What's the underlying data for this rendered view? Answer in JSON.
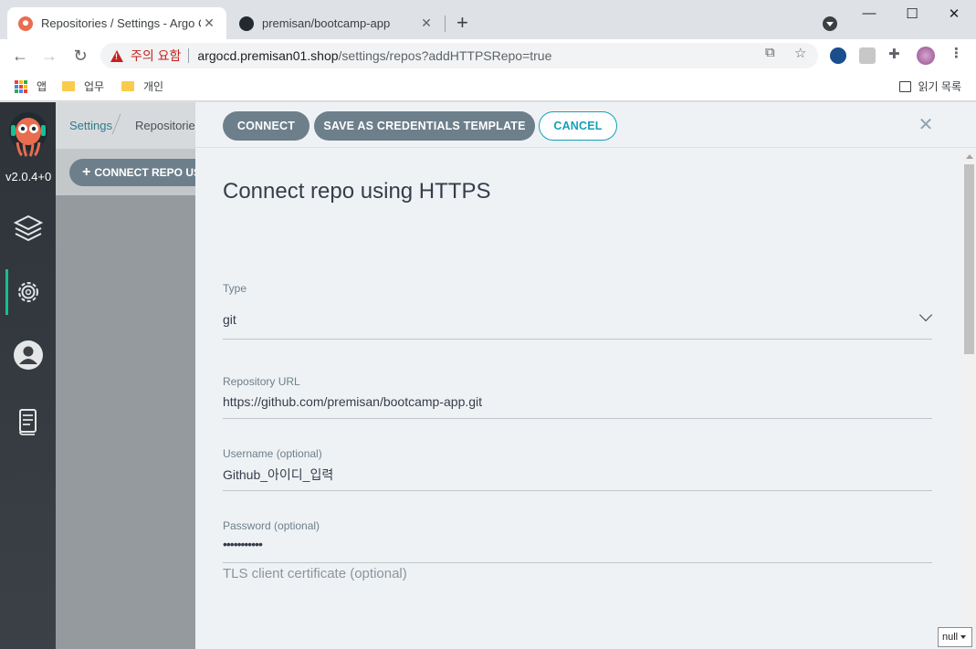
{
  "browser": {
    "tabs": [
      {
        "title": "Repositories / Settings - Argo CD",
        "close": "✕"
      },
      {
        "title": "premisan/bootcamp-app",
        "close": "✕"
      }
    ],
    "new_tab": "+",
    "window_controls": {
      "minimize": "—",
      "maximize": "☐",
      "close": "✕"
    },
    "security_warning": "주의 요함",
    "url_host": "argocd.premisan01.shop",
    "url_path": "/settings/repos?addHTTPSRepo=true",
    "bookmarks": [
      {
        "label": "앱",
        "icon": "apps-grid-icon"
      },
      {
        "label": "업무",
        "icon": "folder-icon"
      },
      {
        "label": "개인",
        "icon": "folder-icon"
      }
    ],
    "reading_list": "읽기 목록",
    "colors": {
      "warning": "#c5221f",
      "folder": "#f9cc4c"
    }
  },
  "app": {
    "version": "v2.0.4+0",
    "breadcrumb": {
      "settings": "Settings",
      "current": "Repositories"
    },
    "connect_repo_button": "CONNECT REPO USING HTTPS",
    "nav_items": [
      "applications-icon",
      "settings-icon",
      "user-icon",
      "docs-icon"
    ],
    "accent_color": "#18be94"
  },
  "panel": {
    "buttons": {
      "connect": "CONNECT",
      "save_template": "SAVE AS CREDENTIALS TEMPLATE",
      "cancel": "CANCEL"
    },
    "close": "✕",
    "title": "Connect repo using HTTPS",
    "fields": {
      "type": {
        "label": "Type",
        "value": "git"
      },
      "repo_url": {
        "label": "Repository URL",
        "value": "https://github.com/premisan/bootcamp-app.git"
      },
      "username": {
        "label": "Username (optional)",
        "value": "Github_아이디_입력"
      },
      "password": {
        "label": "Password (optional)",
        "value": "•••••••••••"
      }
    },
    "tls_section": "TLS client certificate (optional)"
  },
  "overlay_widget": "null"
}
